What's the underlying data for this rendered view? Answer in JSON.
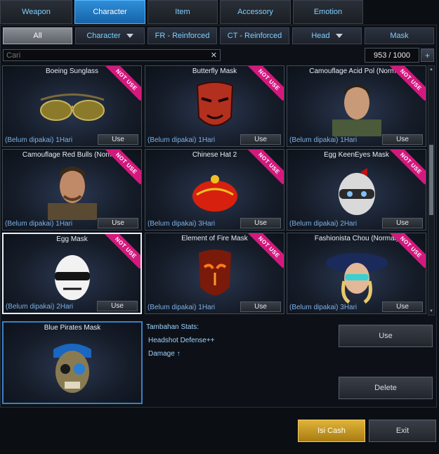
{
  "tabs": [
    {
      "label": "Weapon"
    },
    {
      "label": "Character"
    },
    {
      "label": "Item"
    },
    {
      "label": "Accessory"
    },
    {
      "label": "Emotion"
    }
  ],
  "active_tab": "Character",
  "filters": [
    {
      "label": "All"
    },
    {
      "label": "Character"
    },
    {
      "label": "FR - Reinforced"
    },
    {
      "label": "CT - Reinforced"
    },
    {
      "label": "Head"
    },
    {
      "label": "Mask"
    }
  ],
  "search": {
    "placeholder": "Cari",
    "clear": "✕"
  },
  "count": "953 / 1000",
  "count_plus": "+",
  "badge_text": "NOT USE",
  "use_label": "Use",
  "items": [
    {
      "name": "Boeing Sunglass",
      "status": "(Belum dipakai) 1Hari"
    },
    {
      "name": "Butterfly Mask",
      "status": "(Belum dipakai) 1Hari"
    },
    {
      "name": "Camouflage Acid Pol (Normal)",
      "status": "(Belum dipakai) 1Hari"
    },
    {
      "name": "Camouflage Red Bulls (Normal)",
      "status": "(Belum dipakai) 1Hari"
    },
    {
      "name": "Chinese Hat 2",
      "status": "(Belum dipakai) 3Hari"
    },
    {
      "name": "Egg KeenEyes Mask",
      "status": "(Belum dipakai) 2Hari"
    },
    {
      "name": "Egg Mask",
      "status": "(Belum dipakai) 2Hari"
    },
    {
      "name": "Element of Fire Mask",
      "status": "(Belum dipakai) 1Hari"
    },
    {
      "name": "Fashionista Chou (Normal)",
      "status": "(Belum dipakai) 3Hari"
    }
  ],
  "detail": {
    "name": "Blue Pirates Mask",
    "stats_title": "Tambahan Stats:",
    "stats": [
      "Headshot Defense++",
      "Damage ↑"
    ]
  },
  "buttons": {
    "use": "Use",
    "delete": "Delete",
    "cash": "Isi Cash",
    "exit": "Exit"
  },
  "colors": {
    "accent": "#1e7fd0",
    "badge": "#d4197e",
    "cash": "#c9971f"
  }
}
